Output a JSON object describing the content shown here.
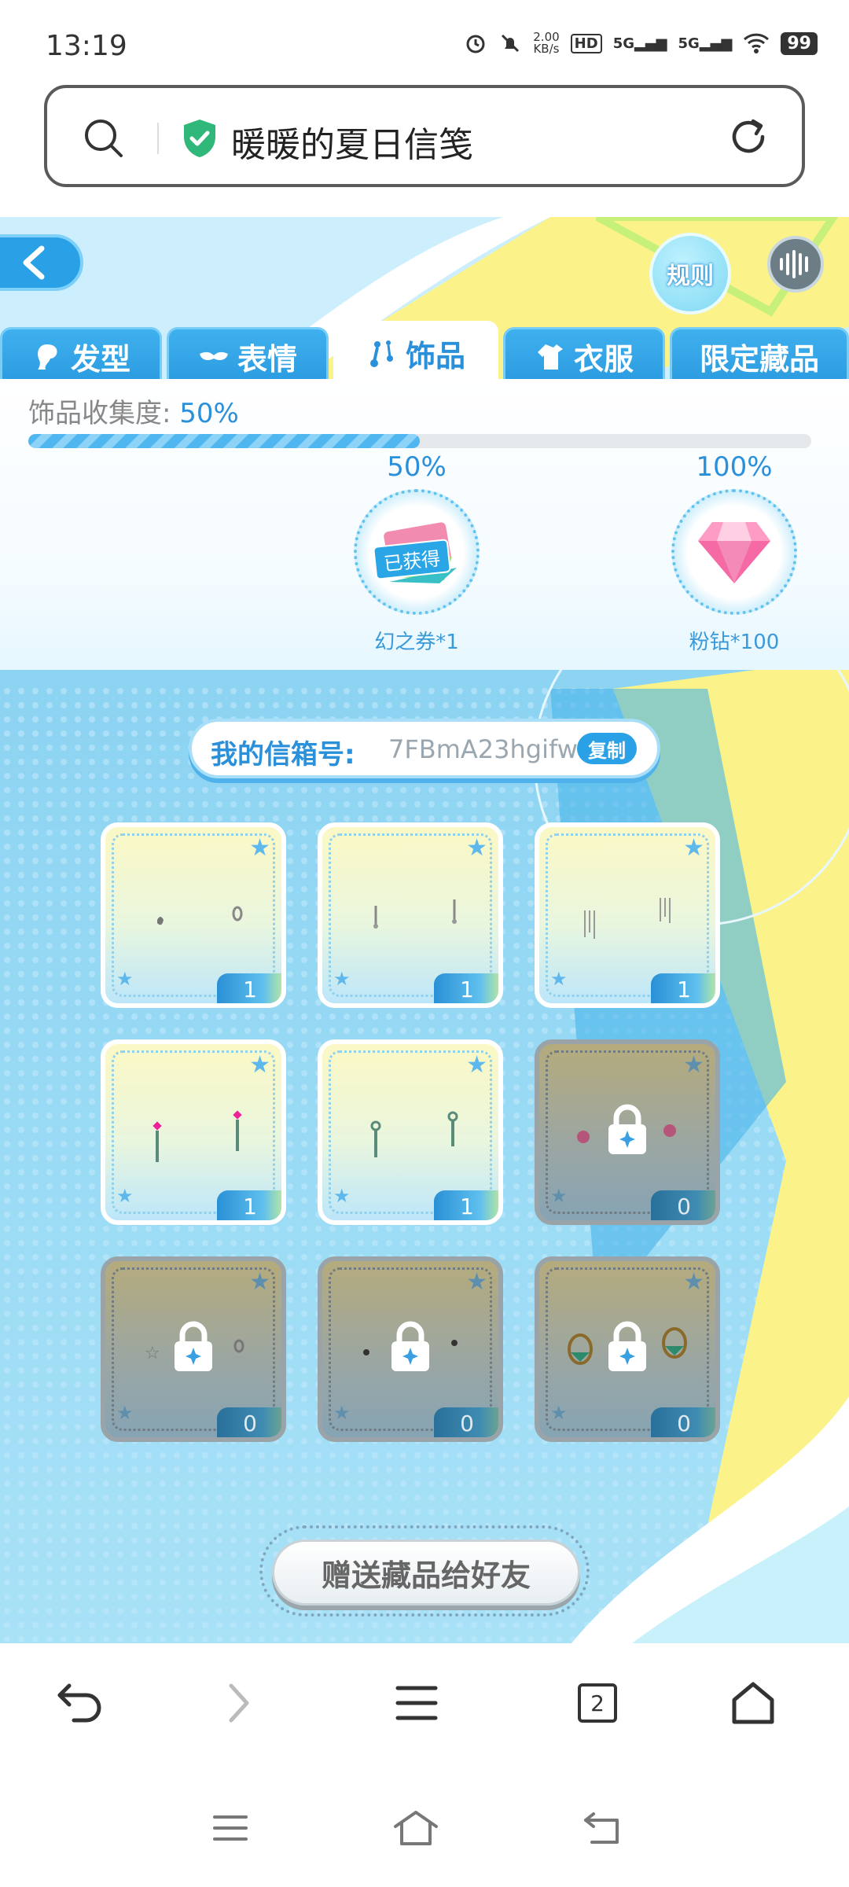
{
  "status_bar": {
    "time": "13:19",
    "net_speed_top": "2.00",
    "net_speed_bottom": "KB/s",
    "hd": "HD",
    "sig1": "5G",
    "sig2": "5G",
    "battery": "99"
  },
  "address_bar": {
    "title": "暖暖的夏日信笺"
  },
  "game": {
    "rules_label": "规则",
    "tabs": [
      {
        "label": "发型",
        "icon": "hair-icon"
      },
      {
        "label": "表情",
        "icon": "mask-icon"
      },
      {
        "label": "饰品",
        "icon": "earring-icon",
        "active": true
      },
      {
        "label": "衣服",
        "icon": "clothes-icon"
      },
      {
        "label": "限定藏品",
        "icon": ""
      }
    ],
    "collection": {
      "label": "饰品收集度:",
      "value": "50%",
      "progress": 0.5
    },
    "milestones": [
      {
        "pct": "50%",
        "reward": "幻之券*1",
        "status": "已获得"
      },
      {
        "pct": "100%",
        "reward": "粉钻*100"
      }
    ],
    "mailbox": {
      "label": "我的信箱号:",
      "id": "7FBmA23hgifw",
      "copy_label": "复制"
    },
    "cards": [
      {
        "count": "1",
        "locked": false
      },
      {
        "count": "1",
        "locked": false
      },
      {
        "count": "1",
        "locked": false
      },
      {
        "count": "1",
        "locked": false
      },
      {
        "count": "1",
        "locked": false
      },
      {
        "count": "0",
        "locked": true
      },
      {
        "count": "0",
        "locked": true
      },
      {
        "count": "0",
        "locked": true
      },
      {
        "count": "0",
        "locked": true
      }
    ],
    "gift_button": "赠送藏品给好友"
  },
  "browser_nav": {
    "tab_count": "2"
  },
  "colors": {
    "accent": "#2a90da",
    "tab_blue": "#3fb0ee",
    "sky": "#8fd3f0"
  }
}
